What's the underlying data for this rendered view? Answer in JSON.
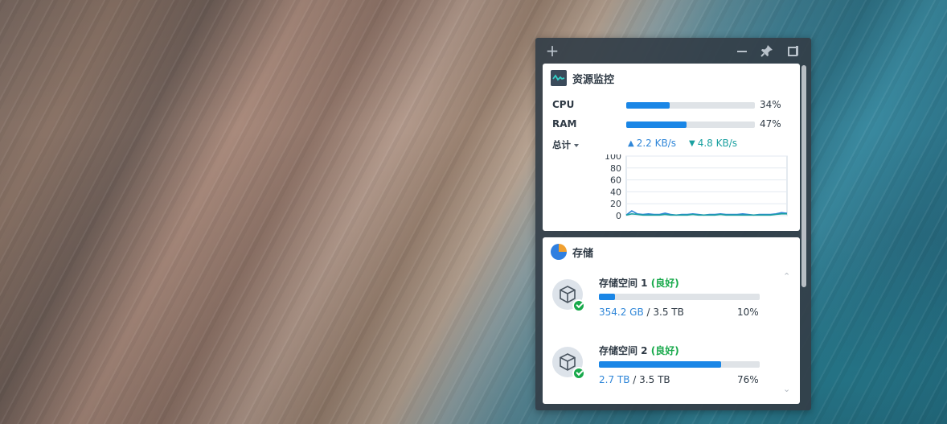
{
  "widget_toolbar": {
    "add_icon": "plus-icon",
    "minimize_icon": "minus-icon",
    "pin_icon": "pin-icon",
    "layout_icon": "layout-icon"
  },
  "resource_monitor": {
    "title": "资源监控",
    "icon": "monitor-icon",
    "cpu": {
      "label": "CPU",
      "percent_text": "34%",
      "percent": 34
    },
    "ram": {
      "label": "RAM",
      "percent_text": "47%",
      "percent": 47
    },
    "network": {
      "selector_label": "总计",
      "upload": "2.2 KB/s",
      "download": "4.8 KB/s"
    },
    "chart_y_ticks": [
      "100",
      "80",
      "60",
      "40",
      "20",
      "0"
    ]
  },
  "chart_data": {
    "type": "line",
    "title": "",
    "xlabel": "",
    "ylabel": "",
    "ylim": [
      0,
      100
    ],
    "yticks": [
      0,
      20,
      40,
      60,
      80,
      100
    ],
    "grid": true,
    "series": [
      {
        "color": "#2f86d8",
        "values": [
          1,
          8,
          3,
          2,
          3,
          2,
          2,
          4,
          2,
          1,
          2,
          2,
          3,
          2,
          1,
          2,
          2,
          3,
          2,
          2,
          2,
          3,
          2,
          1,
          2,
          2,
          2,
          3,
          5,
          4
        ]
      },
      {
        "color": "#1aa0a0",
        "values": [
          1,
          3,
          2,
          1,
          1,
          1,
          1,
          2,
          1,
          1,
          1,
          1,
          2,
          1,
          1,
          1,
          1,
          2,
          1,
          1,
          1,
          1,
          1,
          1,
          1,
          1,
          1,
          2,
          3,
          3
        ]
      }
    ]
  },
  "storage": {
    "title": "存储",
    "icon": "pie-chart-icon",
    "volumes": [
      {
        "name": "存储空间 1",
        "status_open": "(",
        "status": "良好",
        "status_close": ")",
        "used": "354.2 GB",
        "separator": "/",
        "total": "3.5 TB",
        "percent_text": "10%",
        "percent": 10
      },
      {
        "name": "存储空间 2",
        "status_open": "(",
        "status": "良好",
        "status_close": ")",
        "used": "2.7 TB",
        "separator": "/",
        "total": "3.5 TB",
        "percent_text": "76%",
        "percent": 76
      }
    ]
  },
  "colors": {
    "accent": "#1a86e6",
    "healthy": "#18a94b",
    "upload": "#2f86d8",
    "download": "#1aa0a0"
  }
}
